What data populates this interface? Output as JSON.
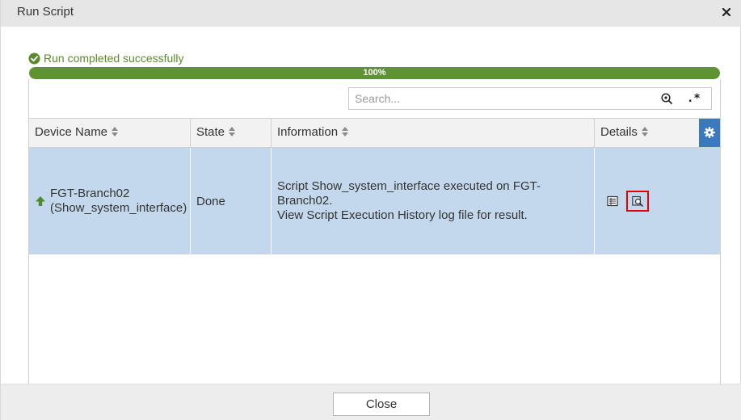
{
  "window": {
    "title": "Run Script",
    "close_icon": "close-icon"
  },
  "status": {
    "text": "Run completed successfully",
    "icon": "check-circle-icon",
    "color": "#5b8a2a"
  },
  "progress": {
    "value": 1.0,
    "label": "100%",
    "color": "#5f9231"
  },
  "search": {
    "placeholder": "Search...",
    "value": "",
    "search_icon": "search-icon",
    "regex_icon": "regex-icon",
    "regex_glyph": ".*"
  },
  "table": {
    "columns": [
      {
        "label": "Device Name"
      },
      {
        "label": "State"
      },
      {
        "label": "Information"
      },
      {
        "label": "Details"
      }
    ],
    "settings_icon": "gear-icon",
    "rows": [
      {
        "device_name": "FGT-Branch02",
        "device_sub": "(Show_system_interface)",
        "status_icon": "up-arrow-icon",
        "state": "Done",
        "info_line1": "Script Show_system_interface executed on FGT-Branch02.",
        "info_line2": "View Script Execution History log file for result.",
        "details_icons": [
          "list-icon",
          "view-log-icon"
        ]
      }
    ]
  },
  "footer": {
    "close_label": "Close"
  },
  "colors": {
    "accent": "#3a78bf",
    "selected_row": "#c3d8ec",
    "highlight": "#e00000"
  }
}
